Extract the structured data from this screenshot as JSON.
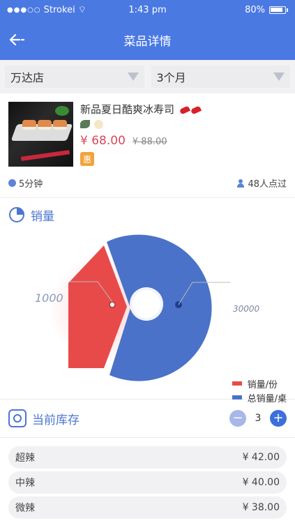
{
  "status": {
    "carrier": "Strokei",
    "time": "1:43 pm",
    "battery": "80%"
  },
  "nav": {
    "title": "菜品详情"
  },
  "filters": {
    "store": "万达店",
    "period": "3个月"
  },
  "dish": {
    "name": "新品夏日酷爽冰寿司",
    "price": "¥ 68.00",
    "old_price": "¥ 88.00",
    "promo": "惠",
    "wait": "5分钟",
    "ordered": "48人点过"
  },
  "sales": {
    "title": "销量",
    "chart_data": {
      "type": "pie",
      "series": [
        {
          "name": "销量/份",
          "value": 1000,
          "color": "#e84a4a"
        },
        {
          "name": "总销量/桌",
          "value": 30000,
          "color": "#4a72c8"
        }
      ],
      "labels": [
        "1000",
        "30000"
      ],
      "legend_position": "bottom-right"
    }
  },
  "inventory": {
    "title": "当前库存",
    "quantity": "3",
    "minus": "−",
    "plus": "+",
    "levels": [
      {
        "label": "超辣",
        "price": "¥ 42.00"
      },
      {
        "label": "中辣",
        "price": "¥ 40.00"
      },
      {
        "label": "微辣",
        "price": "¥ 38.00"
      }
    ]
  }
}
